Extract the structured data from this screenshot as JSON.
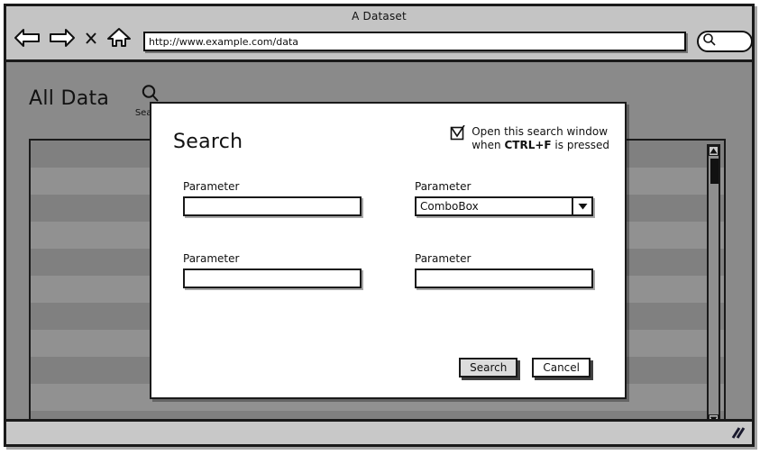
{
  "browser": {
    "window_title": "A Dataset",
    "nav": [
      {
        "name": "back-icon",
        "label": "Back"
      },
      {
        "name": "forward-icon",
        "label": "Forward"
      },
      {
        "name": "stop-icon",
        "label": "Stop"
      },
      {
        "name": "home-icon",
        "label": "Home"
      }
    ],
    "url": "http://www.example.com/data",
    "url_placeholder": "http://",
    "chrome_search_icon": "search-icon"
  },
  "page": {
    "title": "All Data",
    "search_icon": "search-icon",
    "search_label": "Search",
    "table": {
      "row_count": 11,
      "stripe_dark": "#808080",
      "stripe_light": "#919191"
    },
    "scrollbar": {
      "up_arrow": "▲",
      "down_arrow": "▼"
    }
  },
  "statusbar": {
    "resize_grip_icon": "resize-grip-icon"
  },
  "dialog": {
    "title": "Search",
    "checkbox": {
      "checked": true,
      "line1": "Open this search window",
      "line2_prefix": "when ",
      "line2_key": "CTRL+F",
      "line2_suffix": " is pressed"
    },
    "fields": [
      {
        "label": "Parameter",
        "type": "text",
        "value": "",
        "placeholder": ""
      },
      {
        "label": "Parameter",
        "type": "combobox",
        "value": "ComboBox",
        "arrow": "▼"
      },
      {
        "label": "Parameter",
        "type": "text",
        "value": "",
        "placeholder": ""
      },
      {
        "label": "Parameter",
        "type": "text",
        "value": "",
        "placeholder": ""
      }
    ],
    "buttons": {
      "confirm": "Search",
      "cancel": "Cancel"
    }
  },
  "colors": {
    "chrome_bg": "#c4c4c4",
    "page_bg": "#8a8a8a",
    "dialog_bg": "#ffffff",
    "outline": "#1a1a1a",
    "statusbar_bg": "#c8c8c8",
    "primary_button_bg": "#dcdcdc"
  }
}
